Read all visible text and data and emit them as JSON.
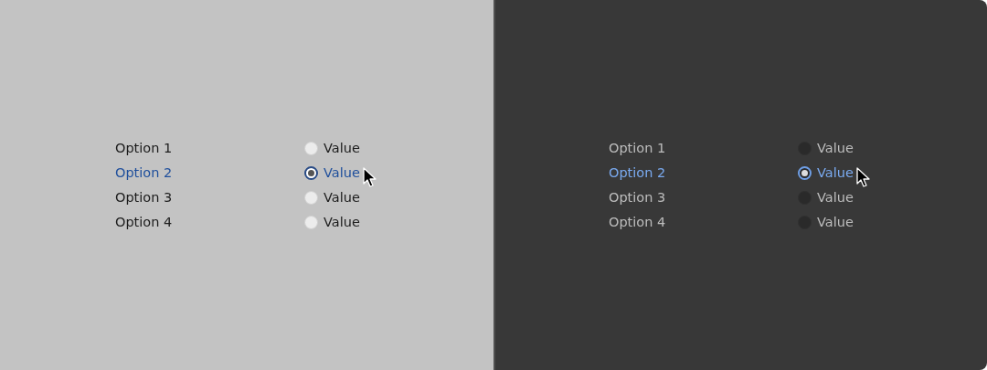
{
  "panels": [
    {
      "kind": "light",
      "rows": [
        {
          "label": "Option 1",
          "value": "Value",
          "selected": false
        },
        {
          "label": "Option 2",
          "value": "Value",
          "selected": true
        },
        {
          "label": "Option 3",
          "value": "Value",
          "selected": false
        },
        {
          "label": "Option 4",
          "value": "Value",
          "selected": false
        }
      ]
    },
    {
      "kind": "dark",
      "rows": [
        {
          "label": "Option 1",
          "value": "Value",
          "selected": false
        },
        {
          "label": "Option 2",
          "value": "Value",
          "selected": true
        },
        {
          "label": "Option 3",
          "value": "Value",
          "selected": false
        },
        {
          "label": "Option 4",
          "value": "Value",
          "selected": false
        }
      ]
    }
  ]
}
